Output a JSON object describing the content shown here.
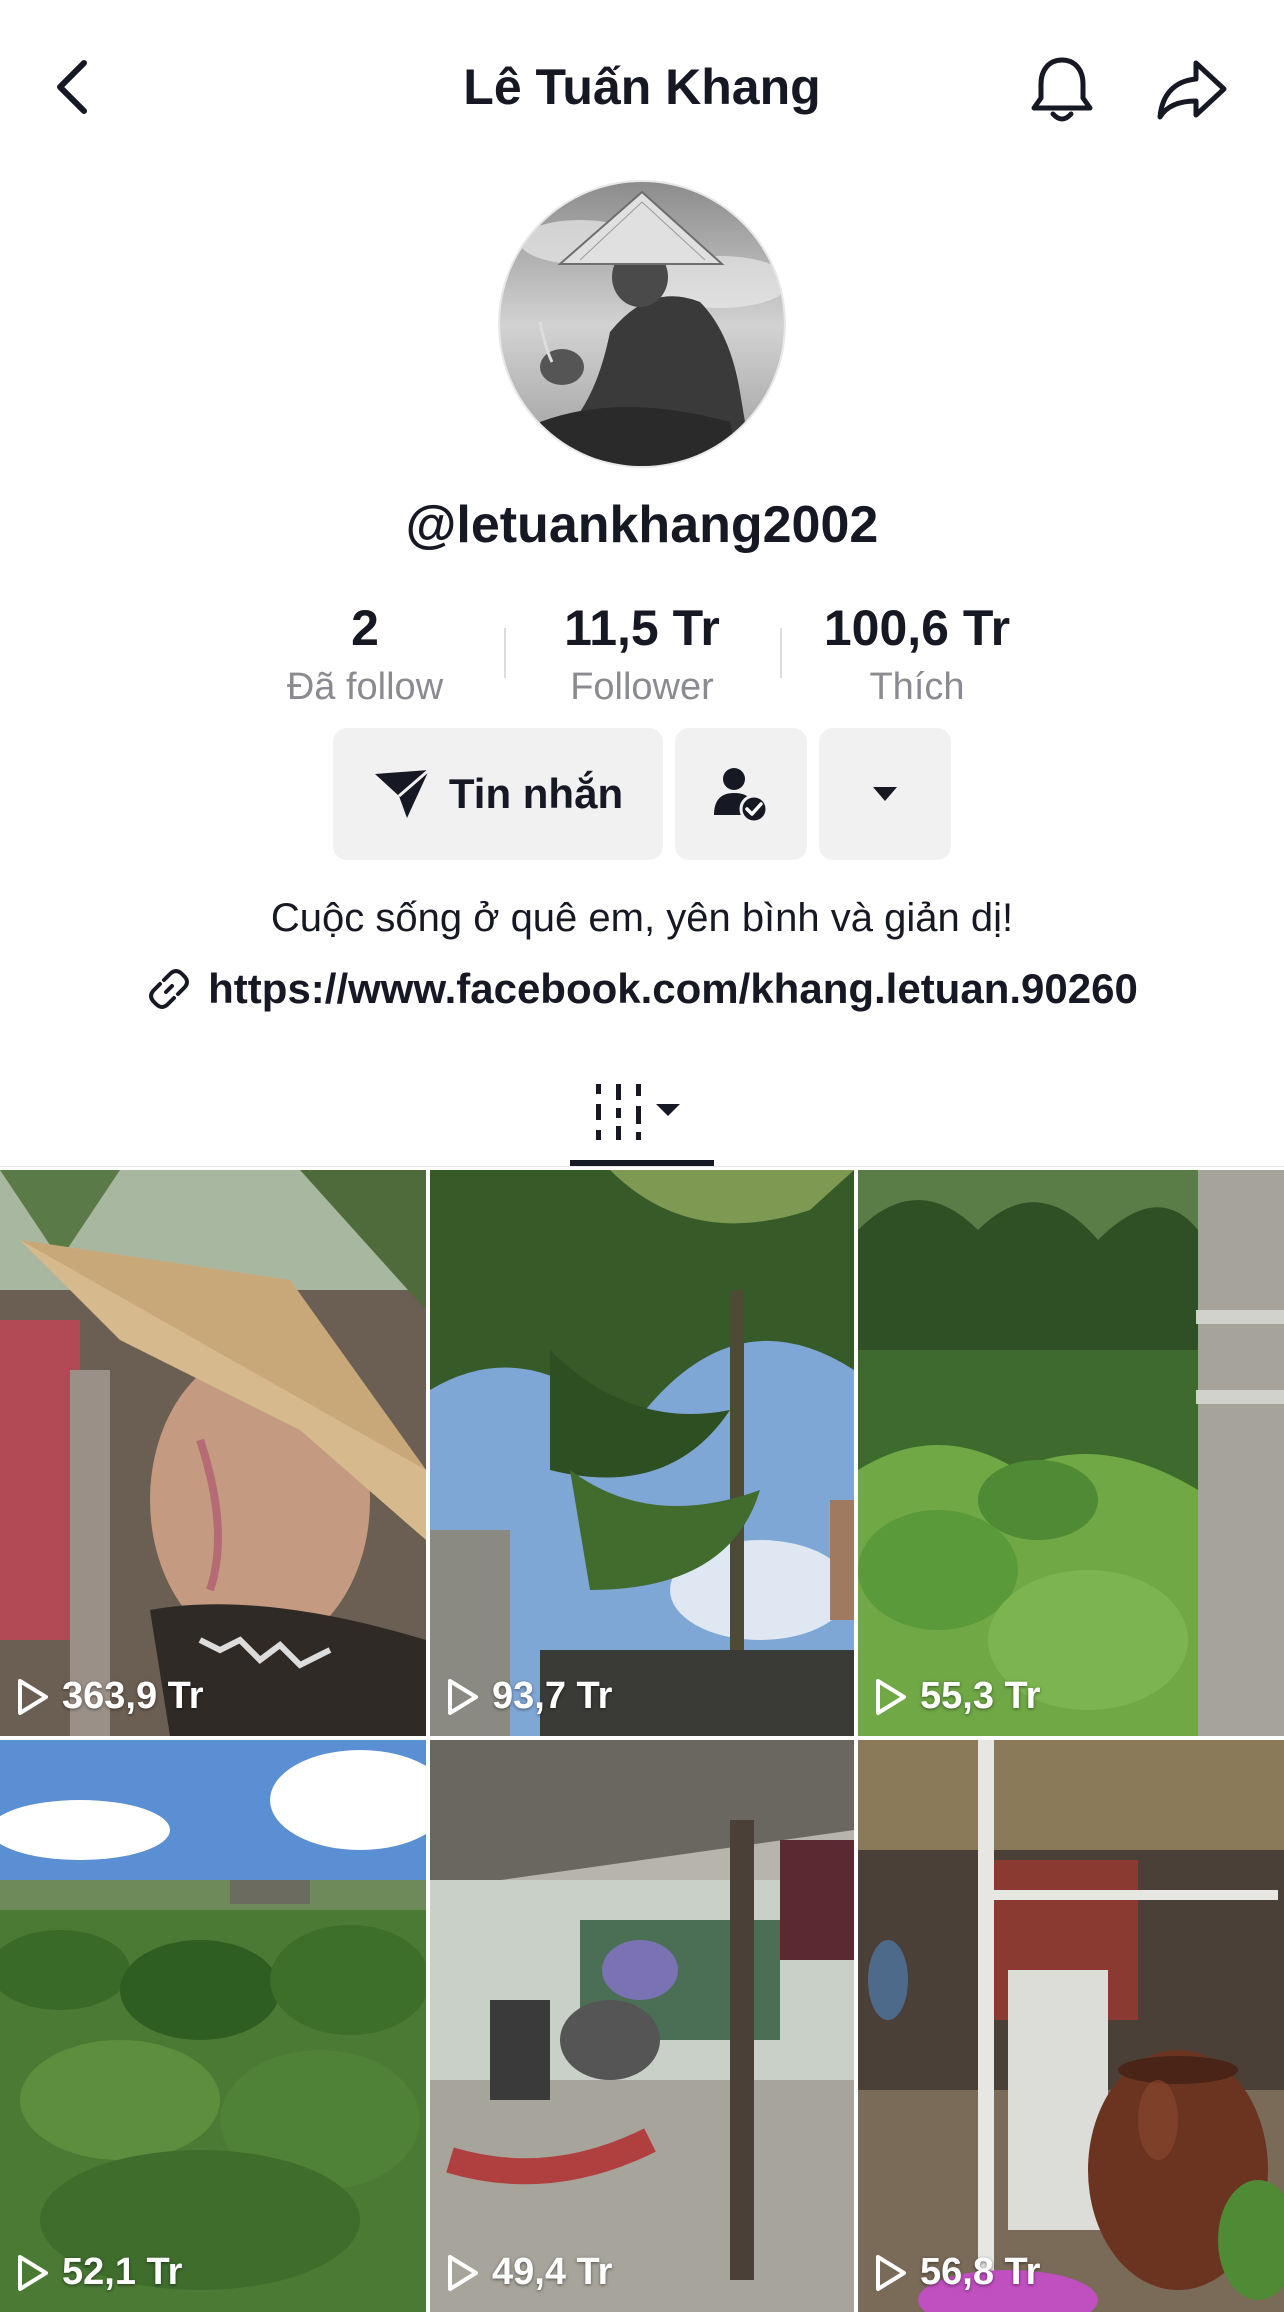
{
  "header": {
    "title": "Lê Tuấn Khang",
    "back_icon": "chevron-left-icon",
    "bell_icon": "bell-icon",
    "share_icon": "share-icon"
  },
  "profile": {
    "username": "@letuankhang2002",
    "stats": [
      {
        "value": "2",
        "label": "Đã follow"
      },
      {
        "value": "11,5 Tr",
        "label": "Follower"
      },
      {
        "value": "100,6 Tr",
        "label": "Thích"
      }
    ],
    "message_label": "Tin nhắn",
    "bio": "Cuộc sống ở quê em, yên bình và giản dị!",
    "link": "https://www.facebook.com/khang.letuan.90260"
  },
  "videos": [
    {
      "views": "363,9 Tr"
    },
    {
      "views": "93,7 Tr"
    },
    {
      "views": "55,3 Tr"
    },
    {
      "views": "52,1 Tr"
    },
    {
      "views": "49,4 Tr"
    },
    {
      "views": "56,8 Tr"
    }
  ],
  "colors": {
    "text": "#161823",
    "muted": "#8a8b91",
    "button_bg": "#f1f1f2"
  }
}
